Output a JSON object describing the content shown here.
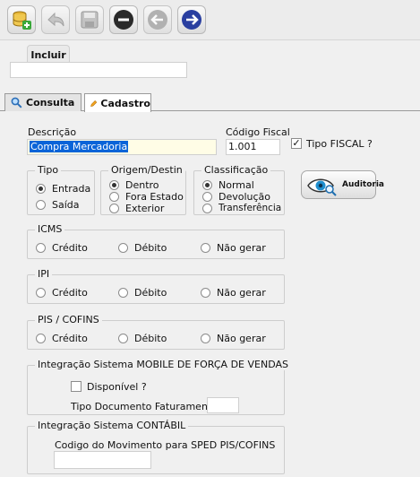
{
  "toolbar": {
    "buttons": [
      {
        "icon": "database-add-icon"
      },
      {
        "icon": "undo-arrow-icon"
      },
      {
        "icon": "save-disk-icon"
      },
      {
        "icon": "minus-circle-icon"
      },
      {
        "icon": "arrow-left-circle-icon"
      },
      {
        "icon": "arrow-right-circle-icon"
      }
    ]
  },
  "incluir_label": "Incluir",
  "top_field_value": "",
  "tabs": [
    {
      "label": "Consulta",
      "icon": "magnifier-icon"
    },
    {
      "label": "Cadastro",
      "icon": "pencil-icon"
    }
  ],
  "form": {
    "descricao_label": "Descrição",
    "descricao_value": "Compra Mercadoria",
    "codigo_fiscal_label": "Código Fiscal",
    "codigo_fiscal_value": "1.001",
    "tipo_fiscal_label": "Tipo FISCAL ?",
    "tipo_fiscal_checked": true
  },
  "tipo": {
    "title": "Tipo",
    "options": [
      "Entrada",
      "Saída"
    ],
    "selected": 0
  },
  "origem": {
    "title": "Origem/Destin",
    "options": [
      "Dentro",
      "Fora Estado",
      "Exterior"
    ],
    "selected": 0
  },
  "classificacao": {
    "title": "Classificação",
    "options": [
      "Normal",
      "Devolução",
      "Transferência"
    ],
    "selected": 0
  },
  "auditoria_label": "Auditoria",
  "icms": {
    "title": "ICMS",
    "options": [
      "Crédito",
      "Débito",
      "Não gerar"
    ]
  },
  "ipi": {
    "title": "IPI",
    "options": [
      "Crédito",
      "Débito",
      "Não gerar"
    ]
  },
  "pis": {
    "title": "PIS / COFINS",
    "options": [
      "Crédito",
      "Débito",
      "Não gerar"
    ]
  },
  "mobile": {
    "title": "Integração Sistema MOBILE DE FORÇA DE VENDAS",
    "disponivel_label": "Disponível ?",
    "tipo_doc_label": "Tipo Documento Faturamento",
    "tipo_doc_value": ""
  },
  "contabil": {
    "title": "Integração Sistema CONTÁBIL",
    "codigo_label": "Codigo do Movimento para SPED PIS/COFINS",
    "codigo_value": ""
  }
}
